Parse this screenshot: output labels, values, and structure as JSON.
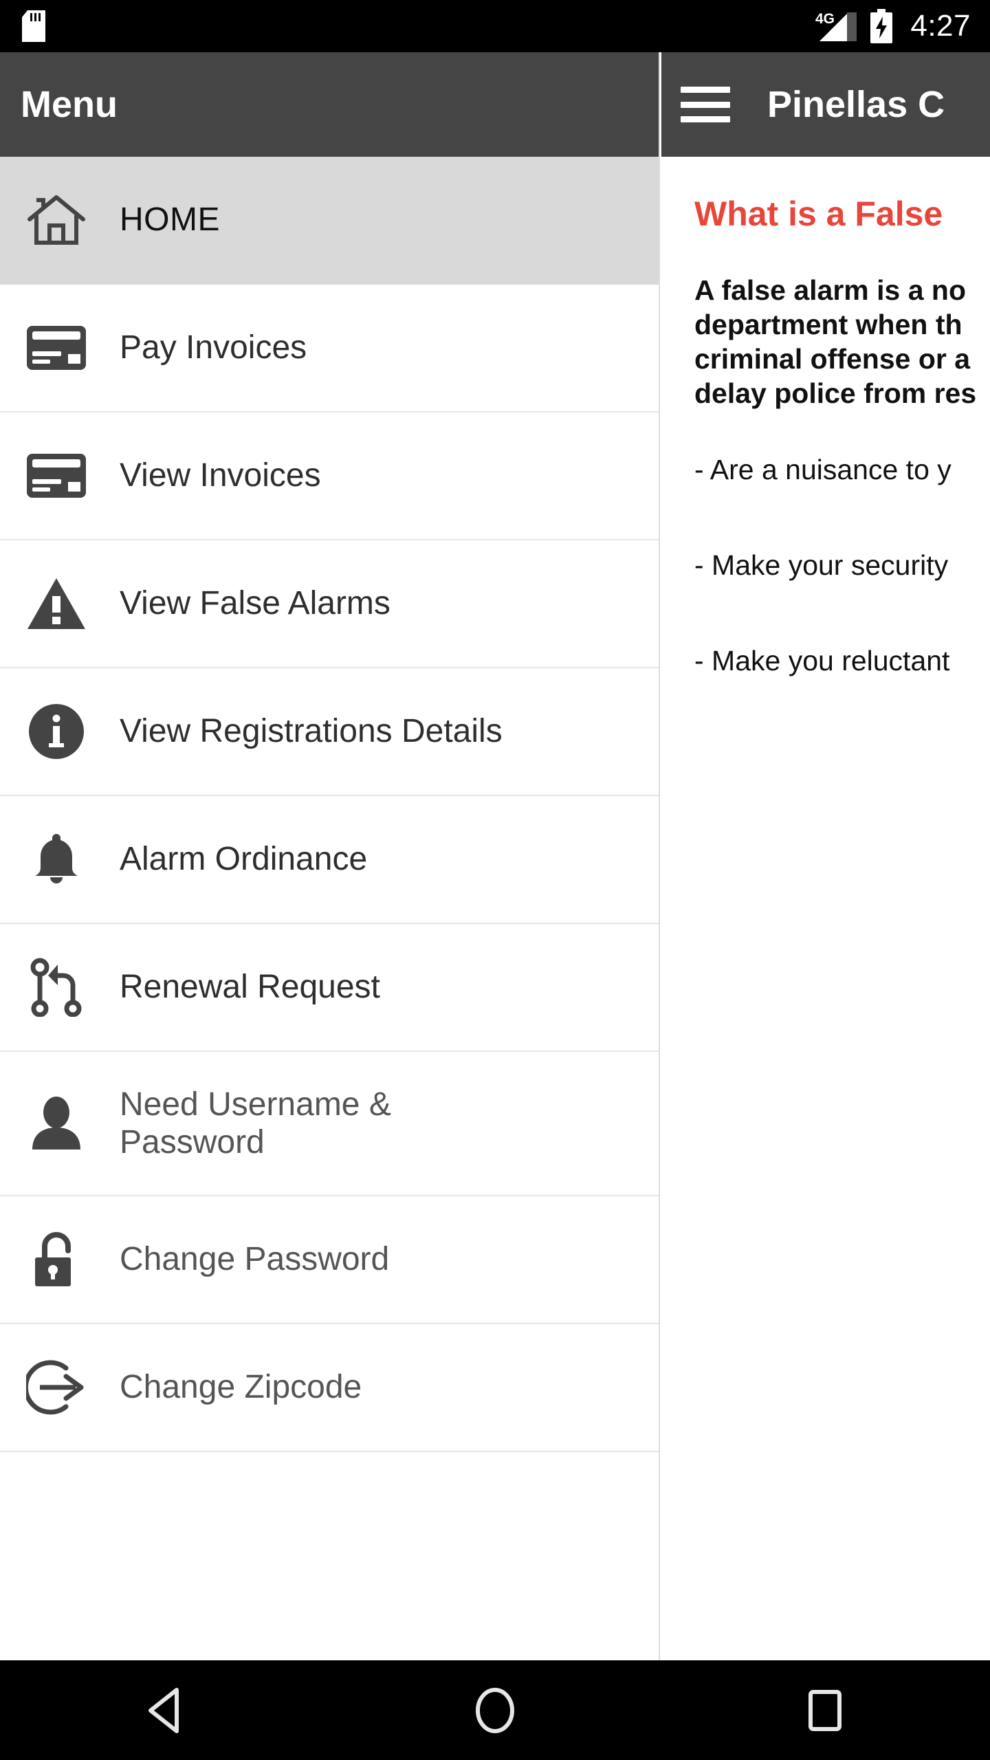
{
  "status_bar": {
    "sd_card_icon": "sd-card-icon",
    "network_label": "4G",
    "signal_icon": "signal-bars-icon",
    "battery_icon": "battery-charging-icon",
    "time": "4:27"
  },
  "app_bar": {
    "menu_icon": "hamburger-menu-icon",
    "title": "Pinellas C"
  },
  "drawer": {
    "header_title": "Menu",
    "items": [
      {
        "label": "HOME",
        "icon": "home-icon",
        "selected": true,
        "muted": false
      },
      {
        "label": "Pay Invoices",
        "icon": "credit-card-icon",
        "selected": false,
        "muted": false
      },
      {
        "label": "View Invoices",
        "icon": "credit-card-icon",
        "selected": false,
        "muted": false
      },
      {
        "label": "View False Alarms",
        "icon": "warning-triangle-icon",
        "selected": false,
        "muted": false
      },
      {
        "label": "View Registrations Details",
        "icon": "info-circle-icon",
        "selected": false,
        "muted": false
      },
      {
        "label": "Alarm Ordinance",
        "icon": "bell-icon",
        "selected": false,
        "muted": false
      },
      {
        "label": "Renewal Request",
        "icon": "branch-merge-icon",
        "selected": false,
        "muted": false
      },
      {
        "label": "Need Username &\nPassword",
        "icon": "person-icon",
        "selected": false,
        "muted": true
      },
      {
        "label": "Change Password",
        "icon": "unlocked-padlock-icon",
        "selected": false,
        "muted": true
      },
      {
        "label": "Change Zipcode",
        "icon": "logout-arrow-icon",
        "selected": false,
        "muted": true
      }
    ]
  },
  "content": {
    "heading": "What is a False ",
    "paragraph": "A false alarm is a no\ndepartment when th\ncriminal offense or a\ndelay police from res",
    "bullets": [
      "- Are a nuisance to y",
      "- Make your security",
      "- Make you reluctant"
    ]
  },
  "nav_bar": {
    "back_icon": "back-triangle-icon",
    "home_icon": "home-circle-icon",
    "recents_icon": "recents-square-icon"
  },
  "colors": {
    "appbar_background": "#454545",
    "heading_red": "#E8463A",
    "selected_row": "#D9D9D9",
    "divider": "#E6E6E6",
    "icon_gray": "#444444",
    "status_bar": "#000000"
  }
}
